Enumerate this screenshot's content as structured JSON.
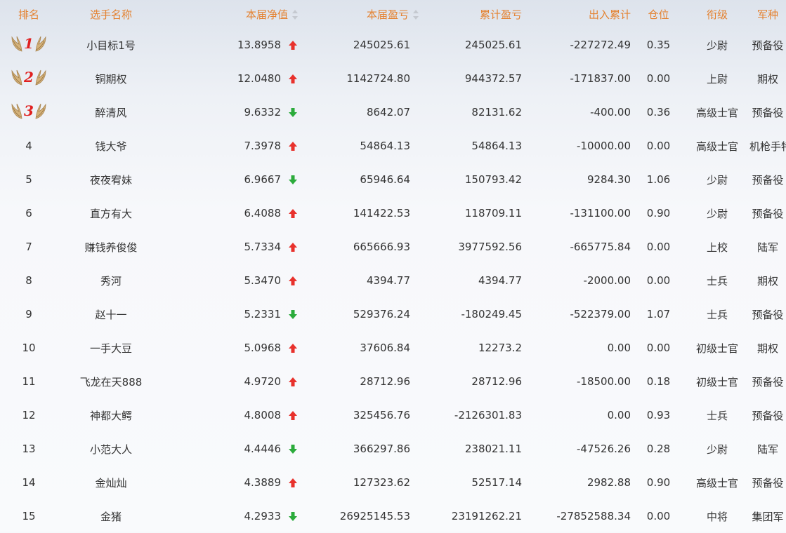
{
  "columns": {
    "rank": "排名",
    "name": "选手名称",
    "nav": "本届净值",
    "pnl": "本届盈亏",
    "cum_pnl": "累计盈亏",
    "flow": "出入累计",
    "position": "仓位",
    "grade": "衔级",
    "branch": "军种"
  },
  "rows": [
    {
      "rank": "1",
      "name": "小目标1号",
      "nav": "13.8958",
      "trend": "up",
      "pnl": "245025.61",
      "cum_pnl": "245025.61",
      "flow": "-227272.49",
      "position": "0.35",
      "grade": "少尉",
      "branch": "预备役"
    },
    {
      "rank": "2",
      "name": "铜期权",
      "nav": "12.0480",
      "trend": "up",
      "pnl": "1142724.80",
      "cum_pnl": "944372.57",
      "flow": "-171837.00",
      "position": "0.00",
      "grade": "上尉",
      "branch": "期权"
    },
    {
      "rank": "3",
      "name": "醉清风",
      "nav": "9.6332",
      "trend": "down",
      "pnl": "8642.07",
      "cum_pnl": "82131.62",
      "flow": "-400.00",
      "position": "0.36",
      "grade": "高级士官",
      "branch": "预备役"
    },
    {
      "rank": "4",
      "name": "钱大爷",
      "nav": "7.3978",
      "trend": "up",
      "pnl": "54864.13",
      "cum_pnl": "54864.13",
      "flow": "-10000.00",
      "position": "0.00",
      "grade": "高级士官",
      "branch": "机枪手特战营"
    },
    {
      "rank": "5",
      "name": "夜夜宥妹",
      "nav": "6.9667",
      "trend": "down",
      "pnl": "65946.64",
      "cum_pnl": "150793.42",
      "flow": "9284.30",
      "position": "1.06",
      "grade": "少尉",
      "branch": "预备役"
    },
    {
      "rank": "6",
      "name": "直方有大",
      "nav": "6.4088",
      "trend": "up",
      "pnl": "141422.53",
      "cum_pnl": "118709.11",
      "flow": "-131100.00",
      "position": "0.90",
      "grade": "少尉",
      "branch": "预备役"
    },
    {
      "rank": "7",
      "name": "赚钱养俊俊",
      "nav": "5.7334",
      "trend": "up",
      "pnl": "665666.93",
      "cum_pnl": "3977592.56",
      "flow": "-665775.84",
      "position": "0.00",
      "grade": "上校",
      "branch": "陆军"
    },
    {
      "rank": "8",
      "name": "秀河",
      "nav": "5.3470",
      "trend": "up",
      "pnl": "4394.77",
      "cum_pnl": "4394.77",
      "flow": "-2000.00",
      "position": "0.00",
      "grade": "士兵",
      "branch": "期权"
    },
    {
      "rank": "9",
      "name": "赵十一",
      "nav": "5.2331",
      "trend": "down",
      "pnl": "529376.24",
      "cum_pnl": "-180249.45",
      "flow": "-522379.00",
      "position": "1.07",
      "grade": "士兵",
      "branch": "预备役"
    },
    {
      "rank": "10",
      "name": "一手大豆",
      "nav": "5.0968",
      "trend": "up",
      "pnl": "37606.84",
      "cum_pnl": "12273.2",
      "flow": "0.00",
      "position": "0.00",
      "grade": "初级士官",
      "branch": "期权"
    },
    {
      "rank": "11",
      "name": "飞龙在天888",
      "nav": "4.9720",
      "trend": "up",
      "pnl": "28712.96",
      "cum_pnl": "28712.96",
      "flow": "-18500.00",
      "position": "0.18",
      "grade": "初级士官",
      "branch": "预备役"
    },
    {
      "rank": "12",
      "name": "神都大鳄",
      "nav": "4.8008",
      "trend": "up",
      "pnl": "325456.76",
      "cum_pnl": "-2126301.83",
      "flow": "0.00",
      "position": "0.93",
      "grade": "士兵",
      "branch": "预备役"
    },
    {
      "rank": "13",
      "name": "小范大人",
      "nav": "4.4446",
      "trend": "down",
      "pnl": "366297.86",
      "cum_pnl": "238021.11",
      "flow": "-47526.26",
      "position": "0.28",
      "grade": "少尉",
      "branch": "陆军"
    },
    {
      "rank": "14",
      "name": "金灿灿",
      "nav": "4.3889",
      "trend": "up",
      "pnl": "127323.62",
      "cum_pnl": "52517.14",
      "flow": "2982.88",
      "position": "0.90",
      "grade": "高级士官",
      "branch": "预备役"
    },
    {
      "rank": "15",
      "name": "金猪",
      "nav": "4.2933",
      "trend": "down",
      "pnl": "26925145.53",
      "cum_pnl": "23191262.21",
      "flow": "-27852588.34",
      "position": "0.00",
      "grade": "中将",
      "branch": "集团军"
    }
  ],
  "colors": {
    "header": "#e4812f",
    "up": "#e8312c",
    "down": "#2bab3b",
    "medal_number": "#e02020",
    "wing": "#c9a56a"
  }
}
